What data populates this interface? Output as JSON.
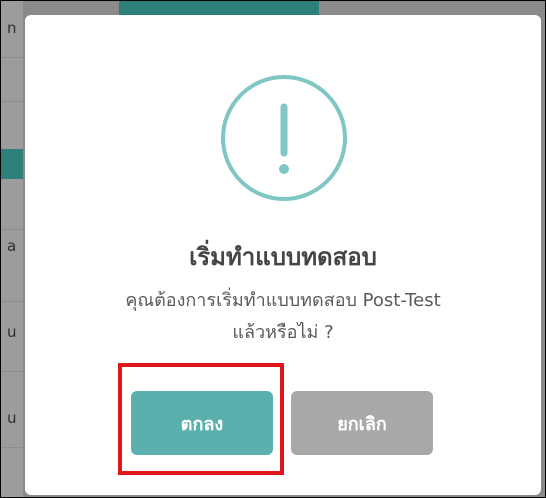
{
  "modal": {
    "title": "เริ่มทำแบบทดสอบ",
    "message_line1": "คุณต้องการเริ่มทำแบบทดสอบ Post-Test",
    "message_line2": "แล้วหรือไม่ ?",
    "confirm_label": "ตกลง",
    "cancel_label": "ยกเลิก",
    "icon": "exclamation-circle-icon"
  },
  "background": {
    "fragments": [
      "n",
      "a",
      "u",
      "u"
    ]
  },
  "colors": {
    "accent": "#5bb0ae",
    "icon_ring": "#7fc6c4",
    "cancel": "#a8a8a8",
    "highlight": "#e0161b",
    "title": "#454545"
  }
}
